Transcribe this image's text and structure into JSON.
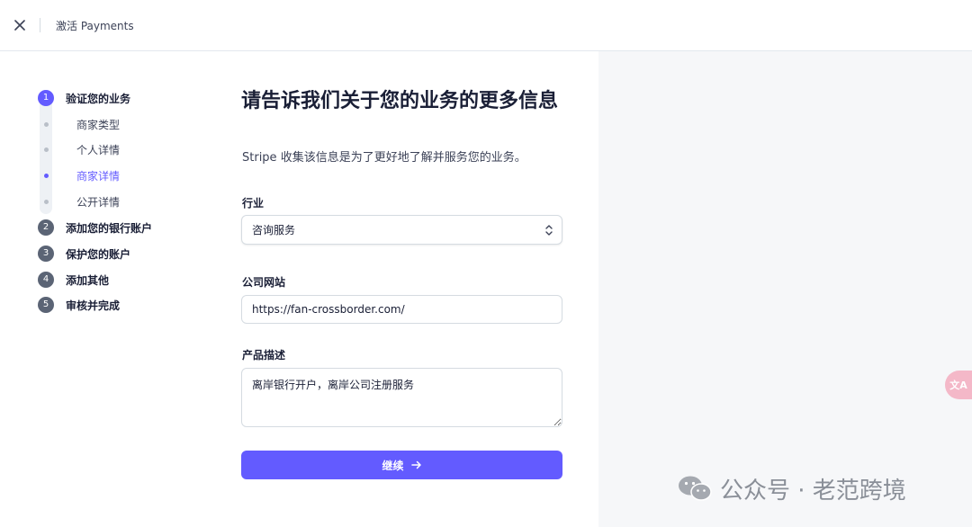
{
  "topbar": {
    "title": "激活 Payments"
  },
  "steps": [
    {
      "number": "1",
      "label": "验证您的业务"
    },
    {
      "number": "2",
      "label": "添加您的银行账户"
    },
    {
      "number": "3",
      "label": "保护您的账户"
    },
    {
      "number": "4",
      "label": "添加其他"
    },
    {
      "number": "5",
      "label": "审核并完成"
    }
  ],
  "substeps": [
    {
      "label": "商家类型"
    },
    {
      "label": "个人详情"
    },
    {
      "label": "商家详情"
    },
    {
      "label": "公开详情"
    }
  ],
  "form": {
    "heading": "请告诉我们关于您的业务的更多信息",
    "subheading": "Stripe 收集该信息是为了更好地了解并服务您的业务。",
    "industry_label": "行业",
    "industry_value": "咨询服务",
    "website_label": "公司网站",
    "website_value": "https://fan-crossborder.com/",
    "description_label": "产品描述",
    "description_value": "离岸银行开户，离岸公司注册服务",
    "continue_label": "继续"
  },
  "translate": {
    "label": "文A"
  },
  "watermark": {
    "text": "公众号 · 老范跨境"
  },
  "colors": {
    "accent": "#635bff",
    "step_inactive": "#5b6475",
    "panel_bg": "#f6f7f9"
  },
  "icons": {
    "close": "close-icon",
    "chevron": "chevron-up-down-icon",
    "arrow": "arrow-right-icon"
  }
}
